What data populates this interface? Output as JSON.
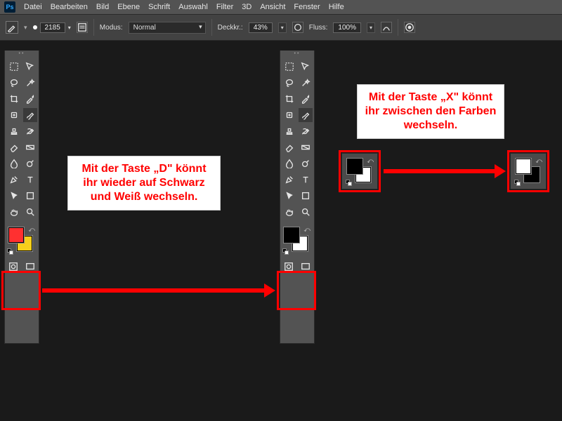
{
  "menu": {
    "items": [
      "Datei",
      "Bearbeiten",
      "Bild",
      "Ebene",
      "Schrift",
      "Auswahl",
      "Filter",
      "3D",
      "Ansicht",
      "Fenster",
      "Hilfe"
    ]
  },
  "options": {
    "brush_size": "2185",
    "mode_label": "Modus:",
    "mode_value": "Normal",
    "deckkr_label": "Deckkr.:",
    "deckkr_value": "43%",
    "fluss_label": "Fluss:",
    "fluss_value": "100%"
  },
  "toolbox1": {
    "fg_color": "#ff3030",
    "bg_color": "#f7cf1b"
  },
  "toolbox2": {
    "fg_color": "#000000",
    "bg_color": "#ffffff"
  },
  "demoA": {
    "fg_color": "#000000",
    "bg_color": "#ffffff"
  },
  "demoB": {
    "fg_color": "#ffffff",
    "bg_color": "#000000"
  },
  "callouts": {
    "d": "Mit der Taste „D\" könnt ihr wieder auf Schwarz und Weiß wechseln.",
    "x": "Mit der Taste „X\" könnt ihr zwischen den Farben wechseln."
  }
}
